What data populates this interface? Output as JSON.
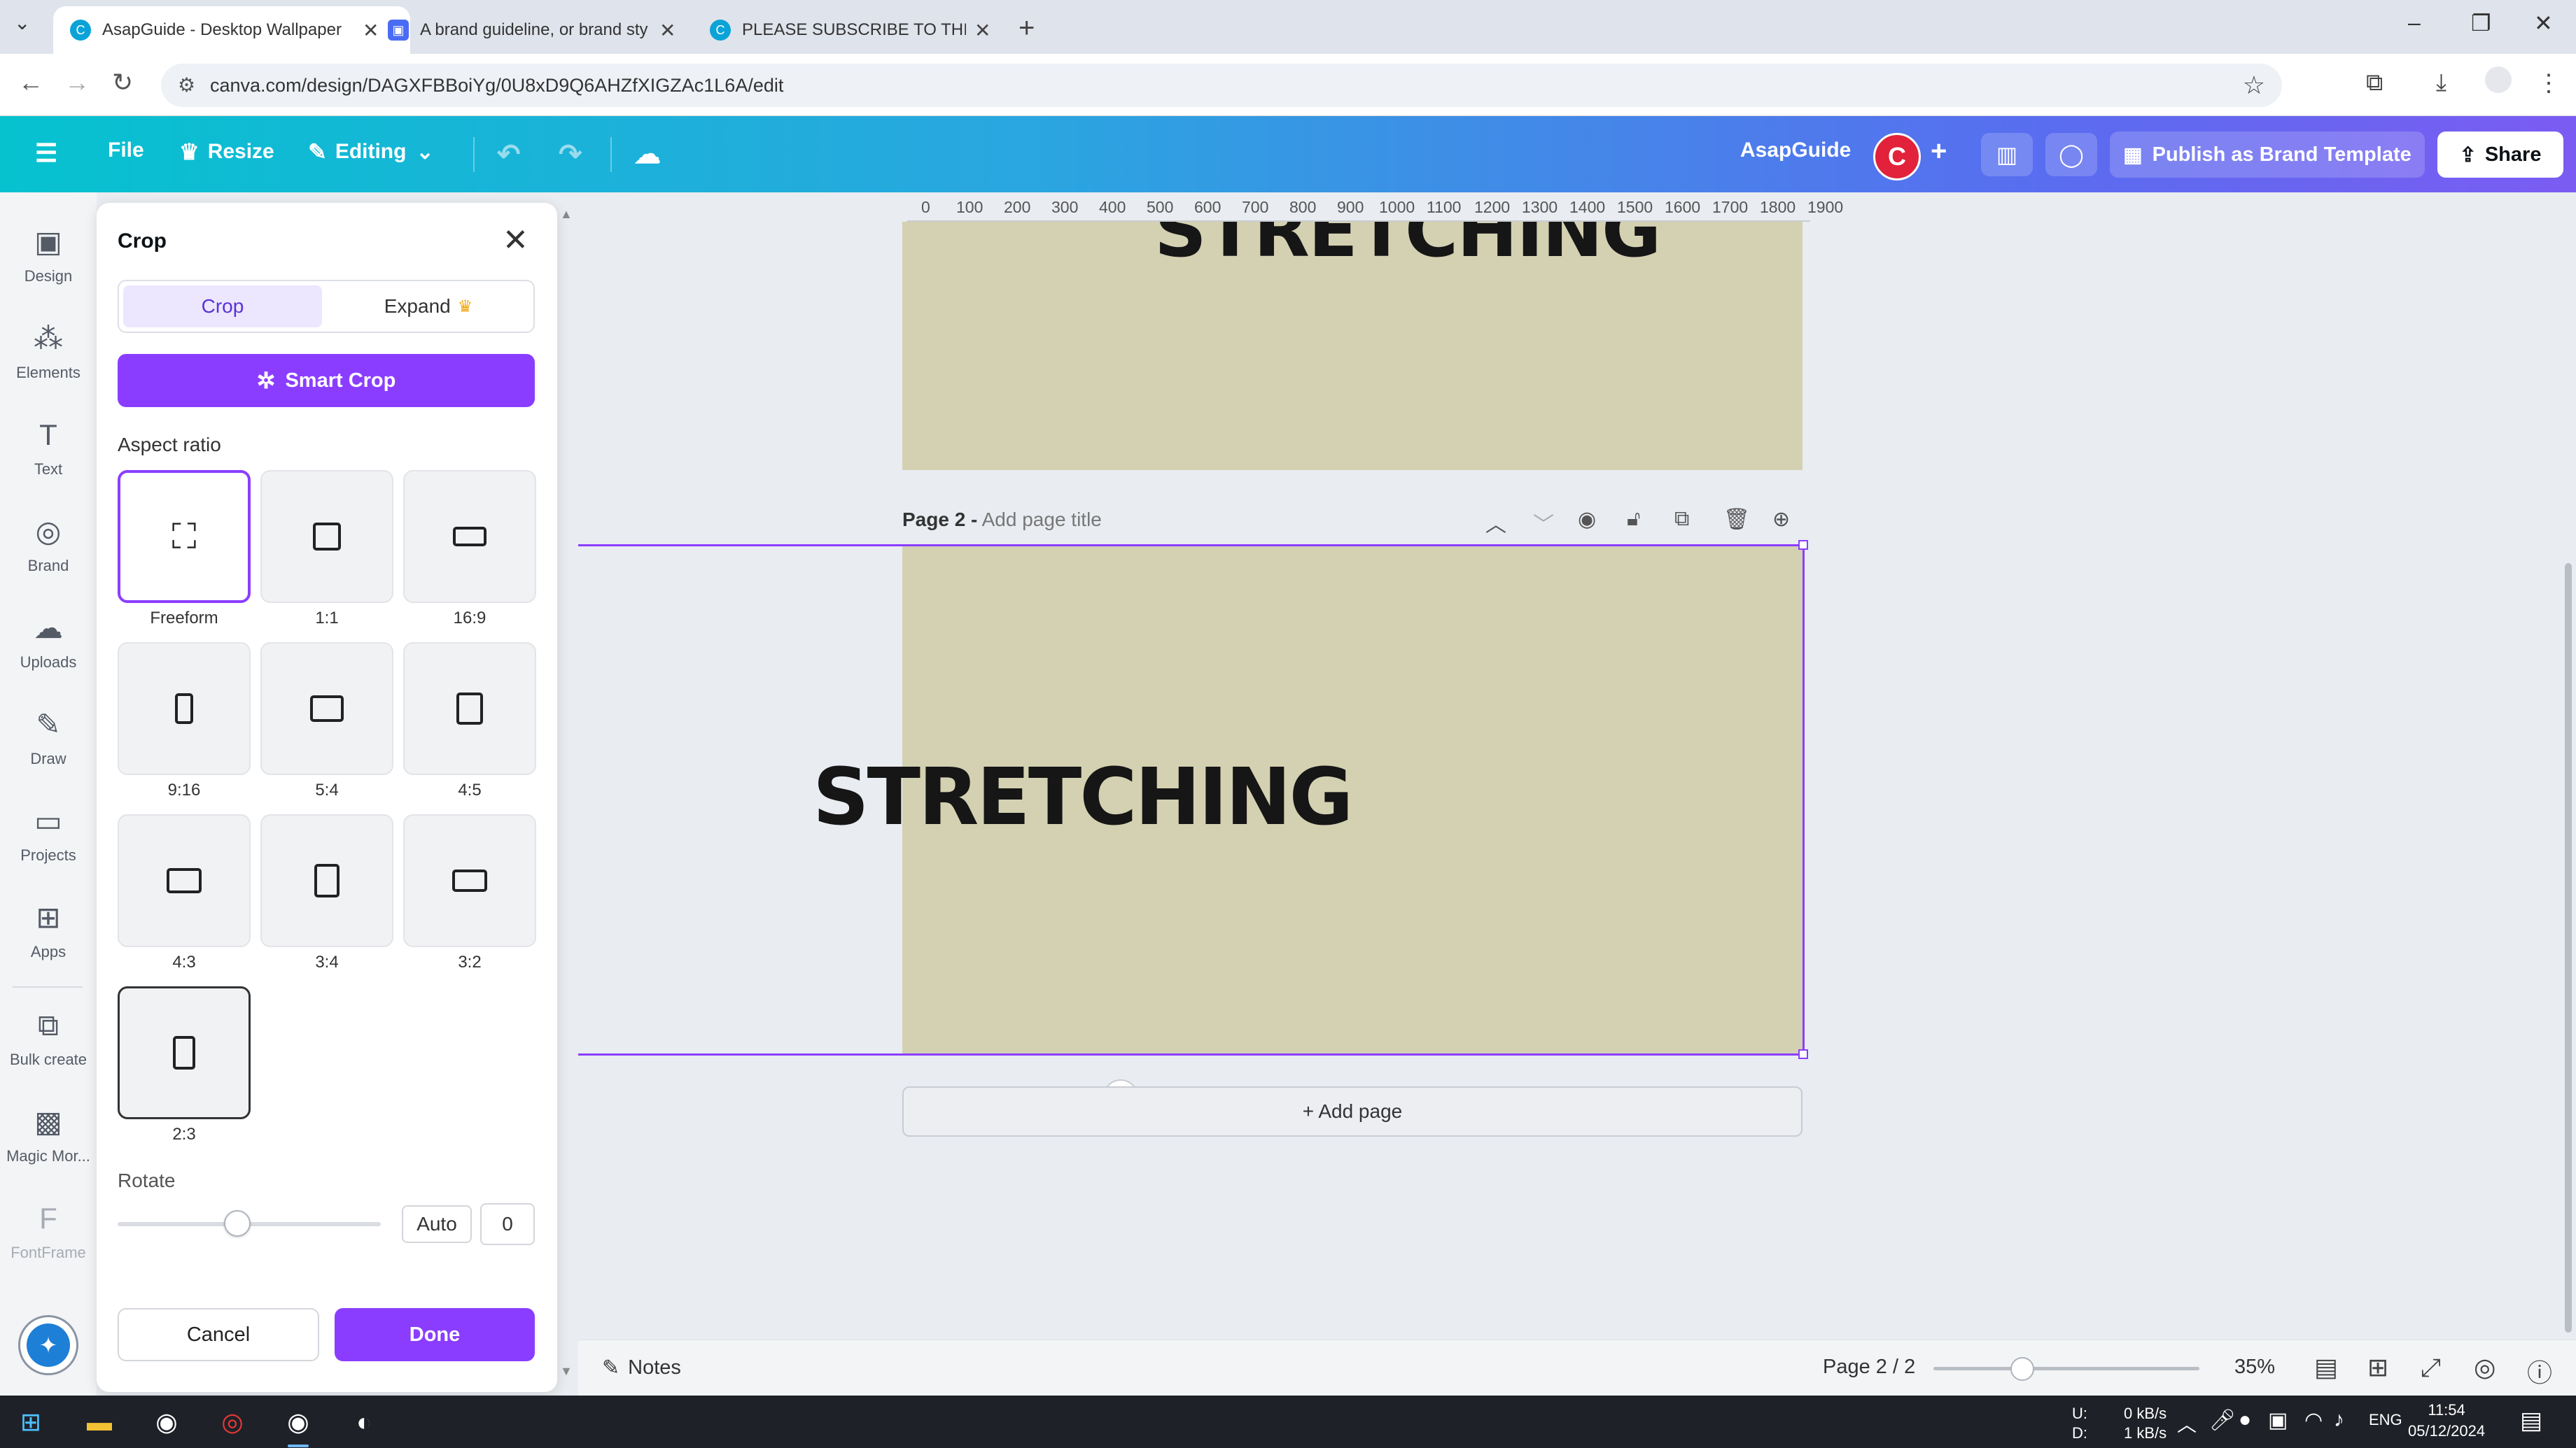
{
  "browser": {
    "tabs": [
      {
        "title": "AsapGuide - Desktop Wallpaper",
        "active": true
      },
      {
        "title": "A brand guideline, or brand sty",
        "active": false
      },
      {
        "title": "PLEASE SUBSCRIBE TO THIS CH",
        "active": false
      }
    ],
    "url": "canva.com/design/DAGXFBBoiYg/0U8xD9Q6AHZfXIGZAc1L6A/edit"
  },
  "header": {
    "file": "File",
    "resize": "Resize",
    "editing": "Editing",
    "brand_name": "AsapGuide",
    "avatar_letter": "C",
    "publish": "Publish as Brand Template",
    "share": "Share"
  },
  "rail": {
    "items": [
      {
        "label": "Design",
        "icon": "design-icon"
      },
      {
        "label": "Elements",
        "icon": "elements-icon"
      },
      {
        "label": "Text",
        "icon": "text-icon"
      },
      {
        "label": "Brand",
        "icon": "brand-icon"
      },
      {
        "label": "Uploads",
        "icon": "uploads-icon"
      },
      {
        "label": "Draw",
        "icon": "draw-icon"
      },
      {
        "label": "Projects",
        "icon": "projects-icon"
      },
      {
        "label": "Apps",
        "icon": "apps-icon"
      },
      {
        "label": "Bulk create",
        "icon": "bulk-create-icon"
      },
      {
        "label": "Magic Mor...",
        "icon": "magic-morph-icon"
      },
      {
        "label": "FontFrame",
        "icon": "fontframe-icon"
      }
    ]
  },
  "crop_panel": {
    "title": "Crop",
    "tab_crop": "Crop",
    "tab_expand": "Expand",
    "smart_crop": "Smart Crop",
    "aspect_ratio_heading": "Aspect ratio",
    "ratios": [
      "Freeform",
      "1:1",
      "16:9",
      "9:16",
      "5:4",
      "4:5",
      "4:3",
      "3:4",
      "3:2",
      "2:3"
    ],
    "rotate_heading": "Rotate",
    "rotate_auto": "Auto",
    "rotate_value": "0",
    "cancel": "Cancel",
    "done": "Done"
  },
  "canvas": {
    "ruler_ticks": [
      "0",
      "100",
      "200",
      "300",
      "400",
      "500",
      "600",
      "700",
      "800",
      "900",
      "1000",
      "1100",
      "1200",
      "1300",
      "1400",
      "1500",
      "1600",
      "1700",
      "1800",
      "1900"
    ],
    "page1_text": "STRETCHING",
    "page2_label": "Page 2 -",
    "page2_title_placeholder": "Add page title",
    "page2_text": "STRETCHING",
    "add_page": "+ Add page",
    "page_bg_color": "#d4d1b2",
    "selection_color": "#8b3dff"
  },
  "bottombar": {
    "notes": "Notes",
    "page_count": "Page 2 / 2",
    "zoom": "35%"
  },
  "taskbar": {
    "net_up_label": "U:",
    "net_down_label": "D:",
    "net_up": "0 kB/s",
    "net_down": "1 kB/s",
    "lang": "ENG",
    "time": "11:54",
    "date": "05/12/2024"
  }
}
